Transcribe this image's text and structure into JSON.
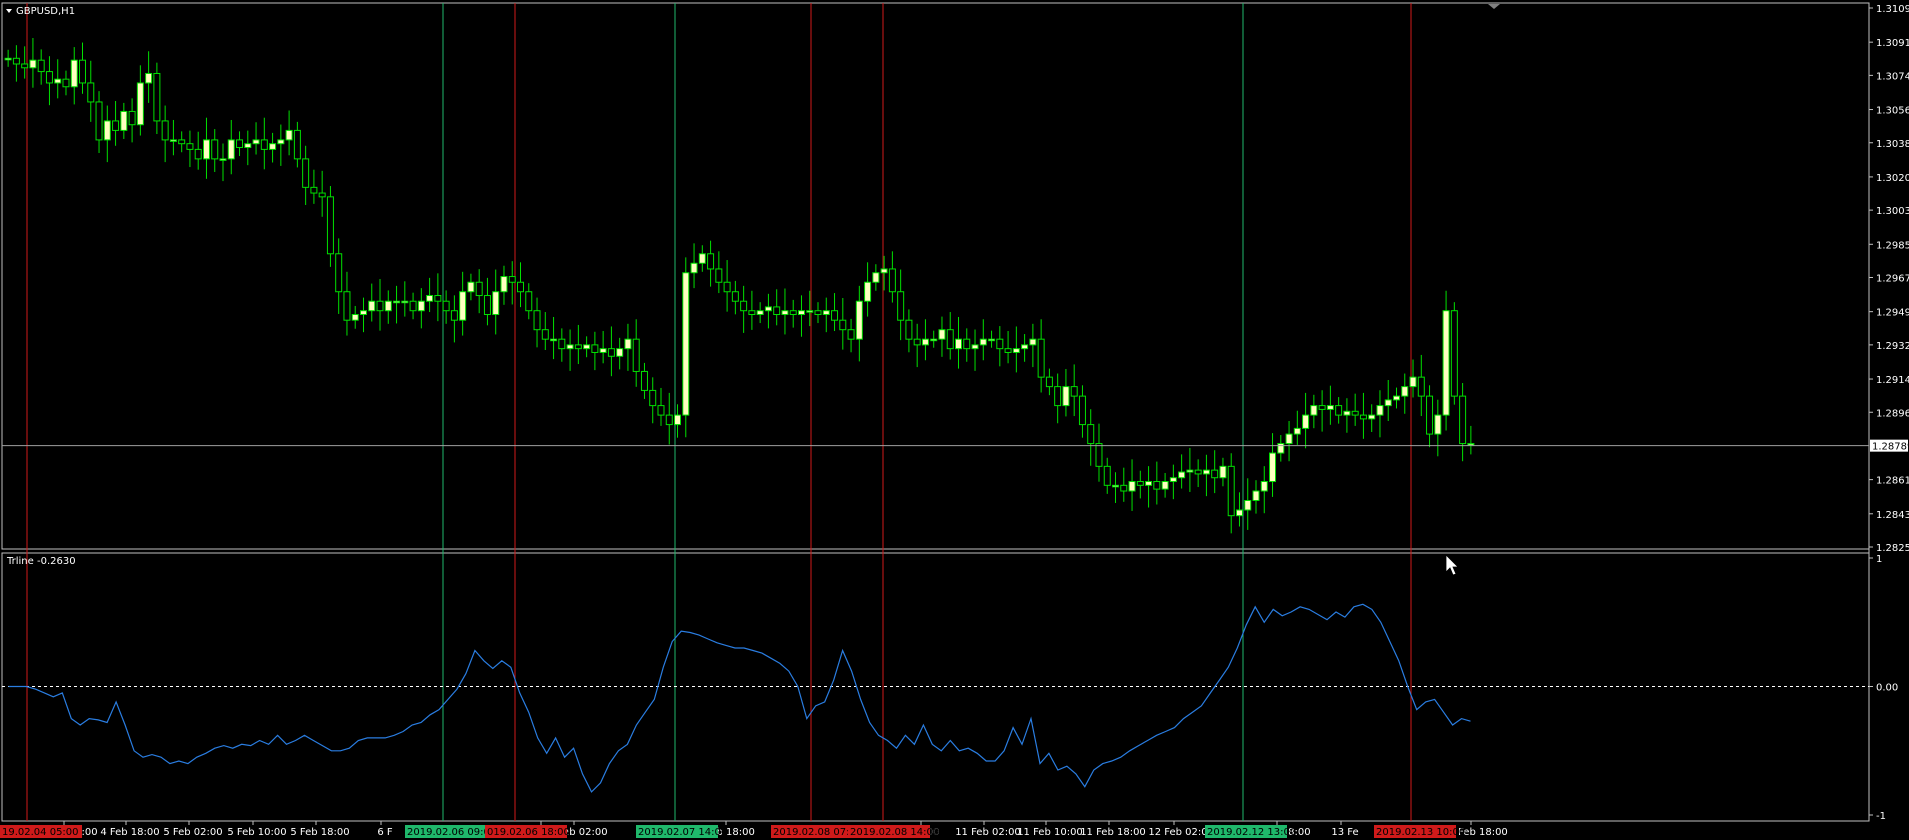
{
  "colors": {
    "background": "#000000",
    "frame": "#c0c0c0",
    "bull_candle": "#ffffc0",
    "candle_outline": "#00e000",
    "vline_green": "#1fb86b",
    "vline_red": "#d01a1a",
    "indicator": "#2a7de1",
    "zero_line": "#ffffff",
    "price_line": "#a0a0a0"
  },
  "main_panel": {
    "title": "GBPUSD,H1",
    "menu_icon": "triangle-down-icon",
    "current_price": "1.28789",
    "price_ticks": [
      "1.31095",
      "1.30915",
      "1.30740",
      "1.30560",
      "1.30385",
      "1.30205",
      "1.30030",
      "1.29850",
      "1.29675",
      "1.29495",
      "1.29320",
      "1.29140",
      "1.28965",
      "1.28610",
      "1.28430",
      "1.28255"
    ]
  },
  "sub_panel": {
    "title": "Trline -0.2630",
    "ticks": [
      "1",
      "0.00",
      "-1"
    ]
  },
  "time_axis": {
    "labels": [
      "4 Feb 10:00",
      "4 Feb 18:00",
      "5 Feb 02:00",
      "5 Feb 10:00",
      "5 Feb 18:00",
      "6 F",
      "00",
      "7 Feb 02:00",
      "Feb 18:00",
      "18:00",
      "11 Feb 02:00",
      "11 Feb 10:00",
      "11 Feb 18:00",
      "12 Feb 02:0",
      "2 Feb 18:00",
      "13 Fe",
      "13 Feb 18:00"
    ],
    "highlight_labels": [
      {
        "text": "19.02.04 05:00",
        "color": "red"
      },
      {
        "text": "2019.02.06 09:00",
        "color": "green"
      },
      {
        "text": "019.02.06 18:00",
        "color": "red"
      },
      {
        "text": "2019.02.07 14:00",
        "color": "green"
      },
      {
        "text": "2019.02.08 07:0",
        "color": "red"
      },
      {
        "text": "2019.02.08 14:00",
        "color": "red"
      },
      {
        "text": "2019.02.12 13:00",
        "color": "green"
      },
      {
        "text": "2019.02.13 10:00",
        "color": "red"
      }
    ]
  },
  "chart_data": [
    {
      "type": "candlestick",
      "title": "GBPUSD,H1",
      "ylim": [
        1.28255,
        1.31095
      ],
      "series": [
        {
          "name": "GBPUSD",
          "values": [
            1.3083,
            1.308,
            1.3078,
            1.3082,
            1.3076,
            1.307,
            1.3072,
            1.3068,
            1.3082,
            1.307,
            1.306,
            1.304,
            1.305,
            1.3045,
            1.3055,
            1.3048,
            1.307,
            1.3075,
            1.305,
            1.304,
            1.304,
            1.3038,
            1.3035,
            1.303,
            1.304,
            1.303,
            1.303,
            1.304,
            1.3036,
            1.3038,
            1.304,
            1.3035,
            1.3038,
            1.304,
            1.3045,
            1.303,
            1.3015,
            1.3012,
            1.301,
            1.298,
            1.296,
            1.2945,
            1.2948,
            1.295,
            1.2955,
            1.295,
            1.2955,
            1.2955,
            1.2955,
            1.295,
            1.2955,
            1.2958,
            1.2955,
            1.295,
            1.2945,
            1.296,
            1.2965,
            1.2958,
            1.2948,
            1.296,
            1.2968,
            1.2965,
            1.296,
            1.295,
            1.294,
            1.2935,
            1.2935,
            1.293,
            1.2932,
            1.293,
            1.2932,
            1.2928,
            1.293,
            1.2926,
            1.293,
            1.2935,
            1.2918,
            1.2908,
            1.29,
            1.2895,
            1.289,
            1.2895,
            1.297,
            1.2975,
            1.298,
            1.2972,
            1.2965,
            1.296,
            1.2955,
            1.295,
            1.2948,
            1.295,
            1.2952,
            1.2948,
            1.295,
            1.2948,
            1.295,
            1.295,
            1.2948,
            1.295,
            1.2945,
            1.294,
            1.2935,
            1.2955,
            1.2965,
            1.297,
            1.2972,
            1.296,
            1.2945,
            1.2935,
            1.2932,
            1.2935,
            1.2935,
            1.294,
            1.293,
            1.2935,
            1.293,
            1.2932,
            1.2935,
            1.2935,
            1.293,
            1.2928,
            1.293,
            1.2932,
            1.2935,
            1.2915,
            1.291,
            1.29,
            1.291,
            1.2905,
            1.289,
            1.288,
            1.2868,
            1.2858,
            1.2858,
            1.2855,
            1.286,
            1.2858,
            1.286,
            1.2856,
            1.286,
            1.2862,
            1.2865,
            1.2866,
            1.2864,
            1.2866,
            1.2862,
            1.2868,
            1.2842,
            1.2845,
            1.285,
            1.2855,
            1.286,
            1.2875,
            1.288,
            1.2885,
            1.2888,
            1.2895,
            1.29,
            1.2898,
            1.29,
            1.2895,
            1.2897,
            1.2895,
            1.2893,
            1.2895,
            1.29,
            1.2903,
            1.2905,
            1.291,
            1.2915,
            1.2905,
            1.2885,
            1.2895,
            1.295,
            1.2905,
            1.288,
            1.288
          ]
        }
      ]
    },
    {
      "type": "line",
      "title": "Trline -0.2630",
      "ylim": [
        -1,
        1
      ],
      "series": [
        {
          "name": "Trline",
          "values": [
            0.0,
            0.0,
            0.0,
            -0.02,
            -0.05,
            -0.08,
            -0.05,
            -0.25,
            -0.3,
            -0.25,
            -0.26,
            -0.28,
            -0.12,
            -0.3,
            -0.5,
            -0.55,
            -0.53,
            -0.55,
            -0.6,
            -0.58,
            -0.6,
            -0.55,
            -0.52,
            -0.48,
            -0.46,
            -0.48,
            -0.45,
            -0.46,
            -0.42,
            -0.45,
            -0.38,
            -0.45,
            -0.42,
            -0.38,
            -0.42,
            -0.46,
            -0.5,
            -0.5,
            -0.48,
            -0.42,
            -0.4,
            -0.4,
            -0.4,
            -0.38,
            -0.35,
            -0.3,
            -0.28,
            -0.22,
            -0.18,
            -0.1,
            -0.02,
            0.1,
            0.28,
            0.2,
            0.14,
            0.2,
            0.15,
            -0.05,
            -0.2,
            -0.4,
            -0.52,
            -0.4,
            -0.55,
            -0.48,
            -0.68,
            -0.82,
            -0.75,
            -0.6,
            -0.5,
            -0.45,
            -0.3,
            -0.2,
            -0.1,
            0.15,
            0.35,
            0.43,
            0.42,
            0.4,
            0.37,
            0.34,
            0.32,
            0.3,
            0.3,
            0.28,
            0.26,
            0.22,
            0.18,
            0.12,
            0.0,
            -0.25,
            -0.15,
            -0.12,
            0.05,
            0.28,
            0.12,
            -0.1,
            -0.28,
            -0.38,
            -0.42,
            -0.48,
            -0.38,
            -0.45,
            -0.3,
            -0.45,
            -0.5,
            -0.42,
            -0.5,
            -0.48,
            -0.52,
            -0.58,
            -0.58,
            -0.5,
            -0.32,
            -0.45,
            -0.25,
            -0.6,
            -0.52,
            -0.65,
            -0.62,
            -0.68,
            -0.78,
            -0.65,
            -0.6,
            -0.58,
            -0.55,
            -0.5,
            -0.46,
            -0.42,
            -0.38,
            -0.35,
            -0.32,
            -0.25,
            -0.2,
            -0.15,
            -0.05,
            0.05,
            0.15,
            0.3,
            0.48,
            0.62,
            0.5,
            0.6,
            0.55,
            0.58,
            0.62,
            0.6,
            0.56,
            0.52,
            0.58,
            0.54,
            0.62,
            0.64,
            0.6,
            0.5,
            0.35,
            0.2,
            0.0,
            -0.18,
            -0.12,
            -0.1,
            -0.2,
            -0.3,
            -0.25,
            -0.27
          ]
        }
      ]
    }
  ]
}
